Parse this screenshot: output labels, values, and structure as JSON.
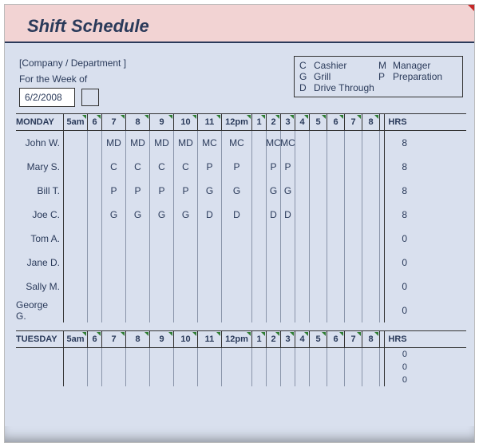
{
  "title": "Shift Schedule",
  "company_placeholder": "[Company / Department ]",
  "week_label": "For the Week of",
  "week_date": "6/2/2008",
  "legend": [
    {
      "code": "C",
      "name": "Cashier"
    },
    {
      "code": "M",
      "name": "Manager"
    },
    {
      "code": "G",
      "name": "Grill"
    },
    {
      "code": "P",
      "name": "Preparation"
    },
    {
      "code": "D",
      "name": "Drive Through"
    }
  ],
  "hours_columns": [
    "5am",
    "6",
    "7",
    "8",
    "9",
    "10",
    "11",
    "12pm",
    "1",
    "2",
    "3",
    "4",
    "5",
    "6",
    "7",
    "8"
  ],
  "hrs_label": "HRS",
  "days": [
    {
      "name": "MONDAY",
      "employees": [
        {
          "name": "John W.",
          "cells": [
            "",
            "",
            "MD",
            "MD",
            "MD",
            "MD",
            "MC",
            "MC",
            "",
            "MC",
            "MC",
            "",
            "",
            "",
            "",
            ""
          ],
          "hrs": "8"
        },
        {
          "name": "Mary S.",
          "cells": [
            "",
            "",
            "C",
            "C",
            "C",
            "C",
            "P",
            "P",
            "",
            "P",
            "P",
            "",
            "",
            "",
            "",
            ""
          ],
          "hrs": "8"
        },
        {
          "name": "Bill T.",
          "cells": [
            "",
            "",
            "P",
            "P",
            "P",
            "P",
            "G",
            "G",
            "",
            "G",
            "G",
            "",
            "",
            "",
            "",
            ""
          ],
          "hrs": "8"
        },
        {
          "name": "Joe C.",
          "cells": [
            "",
            "",
            "G",
            "G",
            "G",
            "G",
            "D",
            "D",
            "",
            "D",
            "D",
            "",
            "",
            "",
            "",
            ""
          ],
          "hrs": "8"
        },
        {
          "name": "Tom A.",
          "cells": [
            "",
            "",
            "",
            "",
            "",
            "",
            "",
            "",
            "",
            "",
            "",
            "",
            "",
            "",
            "",
            ""
          ],
          "hrs": "0"
        },
        {
          "name": "Jane D.",
          "cells": [
            "",
            "",
            "",
            "",
            "",
            "",
            "",
            "",
            "",
            "",
            "",
            "",
            "",
            "",
            "",
            ""
          ],
          "hrs": "0"
        },
        {
          "name": "Sally M.",
          "cells": [
            "",
            "",
            "",
            "",
            "",
            "",
            "",
            "",
            "",
            "",
            "",
            "",
            "",
            "",
            "",
            ""
          ],
          "hrs": "0"
        },
        {
          "name": "George G.",
          "cells": [
            "",
            "",
            "",
            "",
            "",
            "",
            "",
            "",
            "",
            "",
            "",
            "",
            "",
            "",
            "",
            ""
          ],
          "hrs": "0"
        }
      ]
    },
    {
      "name": "TUESDAY",
      "employees": [
        {
          "name": "",
          "cells": [
            "",
            "",
            "",
            "",
            "",
            "",
            "",
            "",
            "",
            "",
            "",
            "",
            "",
            "",
            "",
            ""
          ],
          "hrs": "0"
        },
        {
          "name": "",
          "cells": [
            "",
            "",
            "",
            "",
            "",
            "",
            "",
            "",
            "",
            "",
            "",
            "",
            "",
            "",
            "",
            ""
          ],
          "hrs": "0"
        },
        {
          "name": "",
          "cells": [
            "",
            "",
            "",
            "",
            "",
            "",
            "",
            "",
            "",
            "",
            "",
            "",
            "",
            "",
            "",
            ""
          ],
          "hrs": "0"
        }
      ]
    }
  ]
}
